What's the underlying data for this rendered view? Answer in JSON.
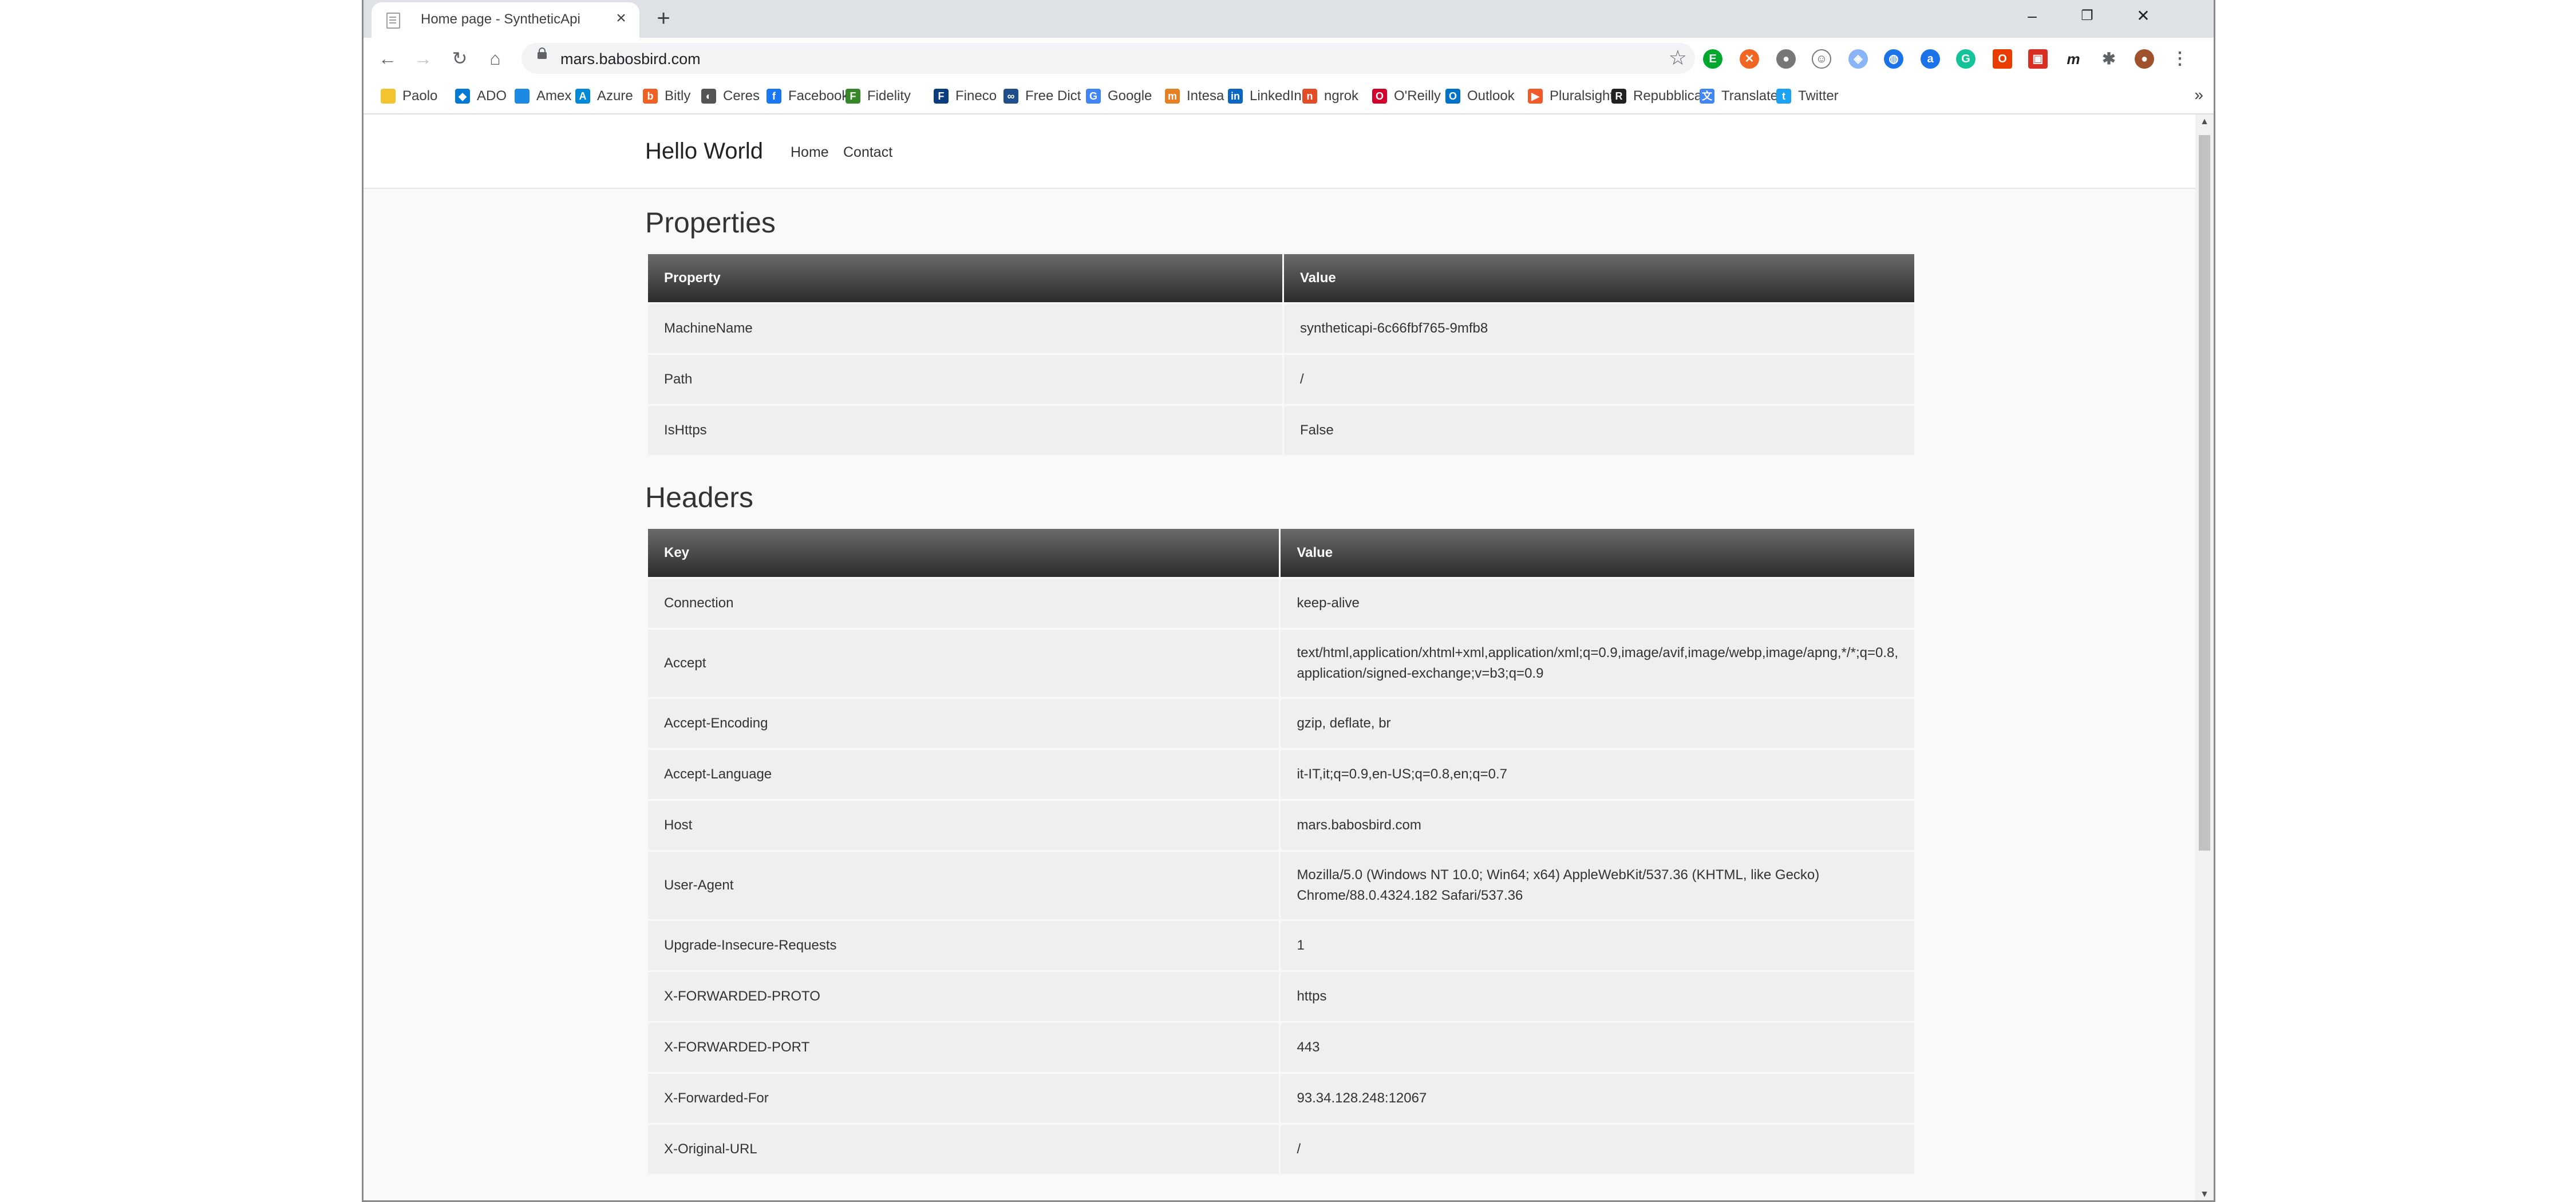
{
  "browser": {
    "tab_title": "Home page - SyntheticApi",
    "url": "mars.babosbird.com",
    "bookmarks": [
      {
        "label": "Paolo",
        "color": "#f4c430",
        "glyph": ""
      },
      {
        "label": "ADO",
        "color": "#0078d4",
        "glyph": "◆"
      },
      {
        "label": "Amex",
        "color": "#1e88e5",
        "glyph": ""
      },
      {
        "label": "Azure",
        "color": "#0089d6",
        "glyph": "A"
      },
      {
        "label": "Bitly",
        "color": "#ee6123",
        "glyph": "b"
      },
      {
        "label": "Ceres",
        "color": "#555555",
        "glyph": "◐"
      },
      {
        "label": "Facebook",
        "color": "#1877f2",
        "glyph": "f"
      },
      {
        "label": "Fidelity",
        "color": "#368727",
        "glyph": "F"
      },
      {
        "label": "Fineco",
        "color": "#0b3c7d",
        "glyph": "F"
      },
      {
        "label": "Free Dict",
        "color": "#1f4e8c",
        "glyph": "∞"
      },
      {
        "label": "Google",
        "color": "#4285f4",
        "glyph": "G"
      },
      {
        "label": "Intesa",
        "color": "#e67e22",
        "glyph": "m"
      },
      {
        "label": "LinkedIn",
        "color": "#0a66c2",
        "glyph": "in"
      },
      {
        "label": "ngrok",
        "color": "#e34c26",
        "glyph": "n"
      },
      {
        "label": "O'Reilly",
        "color": "#d3002d",
        "glyph": "O"
      },
      {
        "label": "Outlook",
        "color": "#0072c6",
        "glyph": "O"
      },
      {
        "label": "Pluralsight",
        "color": "#f15b2a",
        "glyph": "▶"
      },
      {
        "label": "Repubblica",
        "color": "#222222",
        "glyph": "R"
      },
      {
        "label": "Translate",
        "color": "#4285f4",
        "glyph": "文"
      },
      {
        "label": "Twitter",
        "color": "#1da1f2",
        "glyph": "t"
      }
    ],
    "more_label": "»"
  },
  "page": {
    "brand": "Hello World",
    "nav": [
      "Home",
      "Contact"
    ],
    "properties": {
      "title": "Properties",
      "col1": "Property",
      "col2": "Value",
      "rows": [
        [
          "MachineName",
          "syntheticapi-6c66fbf765-9mfb8"
        ],
        [
          "Path",
          "/"
        ],
        [
          "IsHttps",
          "False"
        ]
      ]
    },
    "headers": {
      "title": "Headers",
      "col1": "Key",
      "col2": "Value",
      "rows": [
        [
          "Connection",
          "keep-alive"
        ],
        [
          "Accept",
          "text/html,application/xhtml+xml,application/xml;q=0.9,image/avif,image/webp,image/apng,*/*;q=0.8,\napplication/signed-exchange;v=b3;q=0.9"
        ],
        [
          "Accept-Encoding",
          "gzip, deflate, br"
        ],
        [
          "Accept-Language",
          "it-IT,it;q=0.9,en-US;q=0.8,en;q=0.7"
        ],
        [
          "Host",
          "mars.babosbird.com"
        ],
        [
          "User-Agent",
          "Mozilla/5.0 (Windows NT 10.0; Win64; x64) AppleWebKit/537.36 (KHTML, like Gecko)\nChrome/88.0.4324.182 Safari/537.36"
        ],
        [
          "Upgrade-Insecure-Requests",
          "1"
        ],
        [
          "X-FORWARDED-PROTO",
          "https"
        ],
        [
          "X-FORWARDED-PORT",
          "443"
        ],
        [
          "X-Forwarded-For",
          "93.34.128.248:12067"
        ],
        [
          "X-Original-URL",
          "/"
        ]
      ]
    }
  }
}
